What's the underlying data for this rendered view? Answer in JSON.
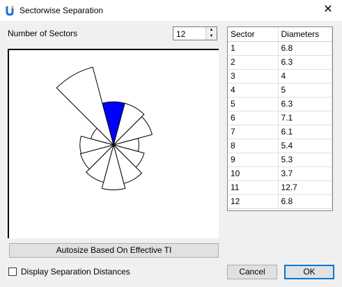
{
  "window": {
    "title": "Sectorwise Separation"
  },
  "sectors_label": "Number of Sectors",
  "sectors_value": "12",
  "table": {
    "headers": [
      "Sector",
      "Diameters"
    ],
    "rows": [
      [
        "1",
        "6.8"
      ],
      [
        "2",
        "6.3"
      ],
      [
        "3",
        "4"
      ],
      [
        "4",
        "5"
      ],
      [
        "5",
        "6.3"
      ],
      [
        "6",
        "7.1"
      ],
      [
        "7",
        "6.1"
      ],
      [
        "8",
        "5.4"
      ],
      [
        "9",
        "5.3"
      ],
      [
        "10",
        "3.7"
      ],
      [
        "11",
        "12.7"
      ],
      [
        "12",
        "6.8"
      ]
    ]
  },
  "rose": {
    "highlight_index": 12,
    "fill": "#ffffff",
    "highlight_fill": "#0000ff",
    "stroke": "#000000"
  },
  "autosize_label": "Autosize Based On Effective TI",
  "checkbox": {
    "label": "Display Separation Distances",
    "checked": false
  },
  "buttons": {
    "cancel": "Cancel",
    "ok": "OK"
  }
}
